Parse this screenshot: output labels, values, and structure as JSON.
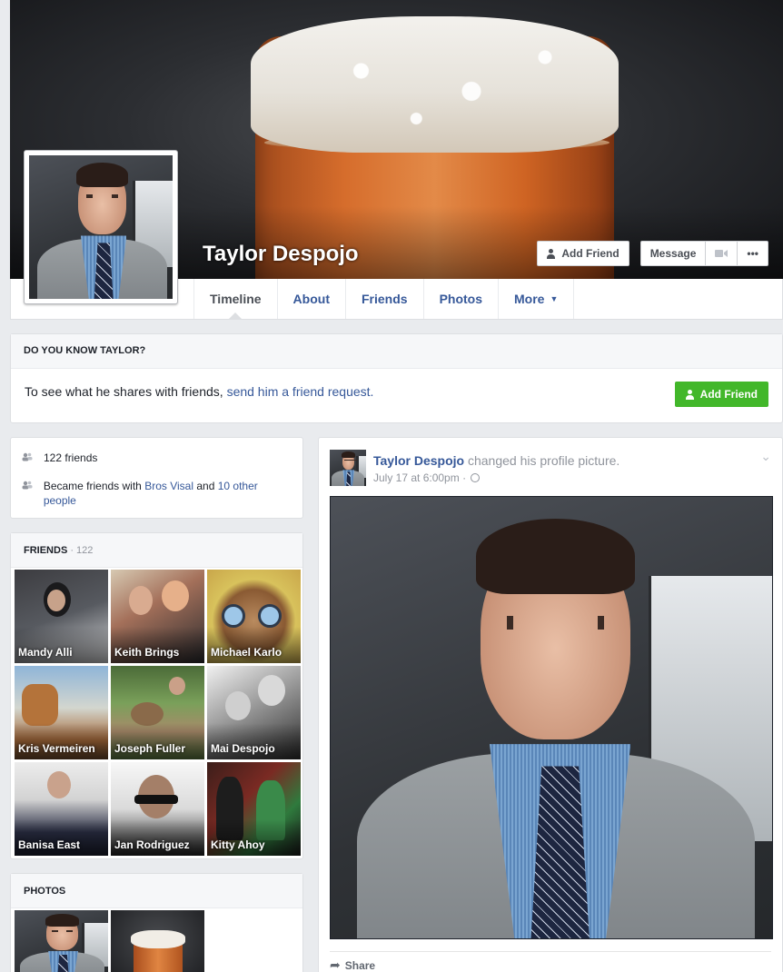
{
  "profile": {
    "name": "Taylor Despojo"
  },
  "cover_actions": {
    "add_friend": "Add Friend",
    "message": "Message",
    "more": "•••"
  },
  "tabs": [
    {
      "label": "Timeline"
    },
    {
      "label": "About"
    },
    {
      "label": "Friends"
    },
    {
      "label": "Photos"
    },
    {
      "label": "More"
    }
  ],
  "know_box": {
    "heading": "DO YOU KNOW TAYLOR?",
    "text": "To see what he shares with friends, ",
    "link": "send him a friend request.",
    "button": "Add Friend"
  },
  "intro": {
    "friends_count": "122 friends",
    "became_prefix": "Became friends with ",
    "became_name": "Bros Visal",
    "became_and": " and ",
    "became_others": "10 other people"
  },
  "friends_section": {
    "title": "FRIENDS",
    "count": " · 122",
    "items": [
      {
        "name": "Mandy Alli"
      },
      {
        "name": "Keith Brings"
      },
      {
        "name": "Michael Karlo"
      },
      {
        "name": "Kris Vermeiren"
      },
      {
        "name": "Joseph Fuller"
      },
      {
        "name": "Mai Despojo"
      },
      {
        "name": "Banisa East"
      },
      {
        "name": "Jan Rodriguez"
      },
      {
        "name": "Kitty Ahoy"
      }
    ]
  },
  "photos_section": {
    "title": "PHOTOS"
  },
  "post": {
    "author": "Taylor Despojo",
    "action": "changed his profile picture.",
    "time": "July 17 at 6:00pm",
    "separator": " · ",
    "share": "Share"
  },
  "colors": {
    "link": "#365899",
    "green_button": "#42b72a",
    "page_bg": "#e9ebee"
  },
  "icons": {
    "add_friend": "person-plus-icon",
    "video": "video-camera-icon",
    "privacy": "globe-icon",
    "share": "share-arrow-icon",
    "chevron": "chevron-down-icon"
  }
}
